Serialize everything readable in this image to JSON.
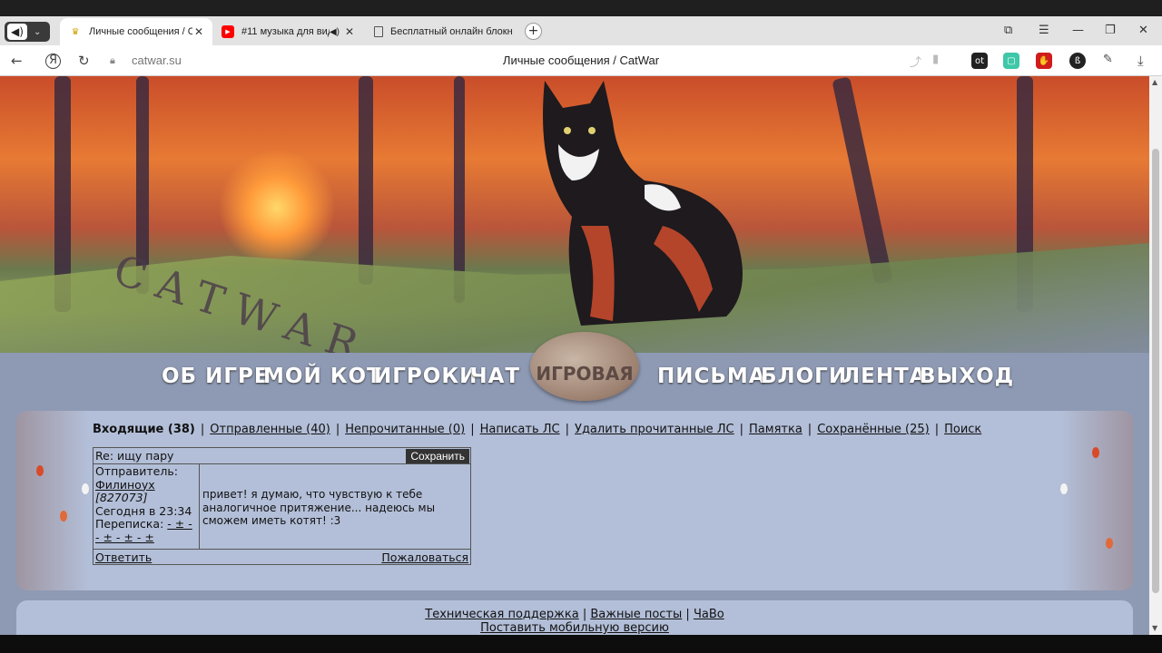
{
  "browser": {
    "tabs": [
      {
        "title": "Личные сообщения / С",
        "active": true,
        "favicon": "catwar-icon"
      },
      {
        "title": "#11 музыка для виде",
        "active": false,
        "favicon": "youtube-icon",
        "audio": true
      },
      {
        "title": "Бесплатный онлайн блокн",
        "active": false,
        "favicon": "document-icon"
      }
    ],
    "url": "catwar.su",
    "page_title": "Личные сообщения / CatWar"
  },
  "site": {
    "nav": [
      "ОБ ИГРЕ",
      "МОЙ КОТ",
      "ИГРОКИ",
      "ЧАТ",
      "ИГРОВАЯ",
      "ПИСЬМА",
      "БЛОГИ",
      "ЛЕНТА",
      "ВЫХОД"
    ],
    "logo_text": "CATWAR"
  },
  "messages_nav": {
    "current": "Входящие (38)",
    "links": [
      "Отправленные (40)",
      "Непрочитанные (0)",
      "Написать ЛС",
      "Удалить прочитанные ЛС",
      "Памятка",
      "Сохранённые (25)",
      "Поиск"
    ]
  },
  "message": {
    "subject": "Re: ищу пару",
    "save_label": "Сохранить",
    "sender_label": "Отправитель:",
    "sender_name": "Филиноух",
    "sender_id": "[827073]",
    "time": "Сегодня в 23:34",
    "thread_label": "Переписка:",
    "thread_line1": "- ± -",
    "thread_line2": "- ± - ± - ±",
    "body": "привет! я думаю, что чувствую к тебе аналогичное притяжение... надеюсь мы сможем иметь котят! :3",
    "reply_label": "Ответить",
    "report_label": "Пожаловаться"
  },
  "footer": {
    "links": [
      "Техническая поддержка",
      "Важные посты",
      "ЧаВо"
    ],
    "mobile_link": "Поставить мобильную версию"
  }
}
